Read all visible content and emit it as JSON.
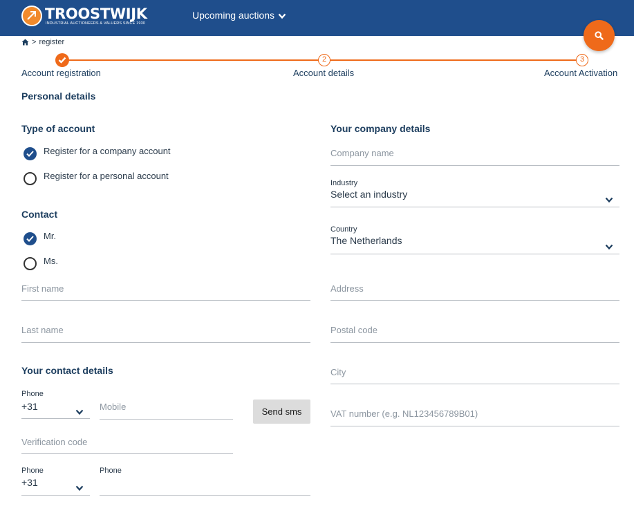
{
  "header": {
    "logo_text": "TROOSTWIJK",
    "logo_tagline": "INDUSTRIAL AUCTIONEERS & VALUERS SINCE 1930",
    "nav_auctions": "Upcoming auctions",
    "brand_color": "#1f4e8c",
    "accent_color": "#ef6a1a"
  },
  "breadcrumb": {
    "separator": ">",
    "current": "register"
  },
  "steps": [
    {
      "label": "Account registration",
      "state": "done"
    },
    {
      "label": "Account details",
      "number": "2"
    },
    {
      "label": "Account Activation",
      "number": "3"
    }
  ],
  "personal": {
    "title": "Personal details",
    "type_title": "Type of account",
    "type_options": [
      {
        "label": "Register for a company account",
        "checked": true
      },
      {
        "label": "Register for a personal account",
        "checked": false
      }
    ],
    "contact_title": "Contact",
    "contact_options": [
      {
        "label": "Mr.",
        "checked": true
      },
      {
        "label": "Ms.",
        "checked": false
      }
    ],
    "first_name_placeholder": "First name",
    "last_name_placeholder": "Last name"
  },
  "contact_details": {
    "title": "Your contact details",
    "phone_label": "Phone",
    "phone_code": "+31",
    "mobile_placeholder": "Mobile",
    "send_sms": "Send sms",
    "verification_placeholder": "Verification code",
    "phone2_label": "Phone",
    "phone2_code": "+31",
    "phone2_field_label": "Phone"
  },
  "company": {
    "title": "Your company details",
    "company_name_placeholder": "Company name",
    "industry_label": "Industry",
    "industry_value": "Select an industry",
    "country_label": "Country",
    "country_value": "The Netherlands",
    "address_placeholder": "Address",
    "postal_placeholder": "Postal code",
    "city_placeholder": "City",
    "vat_placeholder": "VAT number (e.g. NL123456789B01)"
  }
}
